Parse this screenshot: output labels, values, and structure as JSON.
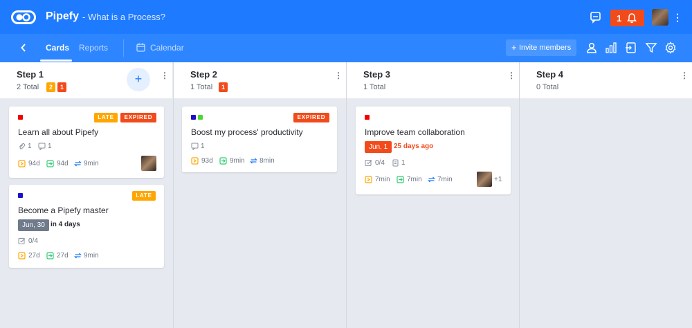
{
  "colors": {
    "primary": "#1e7bff",
    "late": "#ffa600",
    "expired": "#f24b1b",
    "label_red": "#f50000",
    "label_blue": "#1a12c8",
    "label_green": "#4cd631",
    "time_orange": "#ffa600",
    "time_green": "#2ecc71",
    "time_blue": "#1e7bff"
  },
  "topbar": {
    "app_name": "Pipefy",
    "pipe_title": "- What is a Process?",
    "notification_count": "1",
    "icons": [
      "pipefy-logo-icon",
      "chat-icon",
      "bell-icon",
      "user-avatar",
      "kebab-icon"
    ]
  },
  "nav": {
    "tabs": {
      "cards": "Cards",
      "reports": "Reports",
      "calendar": "Calendar"
    },
    "invite_label": "Invite members",
    "invite_plus": "+",
    "icons": [
      "back-icon",
      "calendar-icon",
      "person-icon",
      "bar-chart-icon",
      "import-icon",
      "filter-icon",
      "settings-icon"
    ]
  },
  "columns": [
    {
      "title": "Step 1",
      "total": "2 Total",
      "badges": [
        "2",
        "1"
      ],
      "add_button": "+"
    },
    {
      "title": "Step 2",
      "total": "1 Total",
      "badges": [
        "1"
      ]
    },
    {
      "title": "Step 3",
      "total": "1 Total",
      "badges": []
    },
    {
      "title": "Step 4",
      "total": "0 Total",
      "badges": []
    }
  ],
  "cards": [
    {
      "title": "Learn all about Pipefy",
      "tags": [
        "LATE",
        "EXPIRED"
      ],
      "attachments": "1",
      "comments": "1",
      "time_in_phase": "94d",
      "time_total": "94d",
      "time_cycle": "9min"
    },
    {
      "title": "Become a Pipefy master",
      "tags": [
        "LATE"
      ],
      "due_date": "Jun, 30",
      "due_text": "in 4 days",
      "checklist": "0/4",
      "time_in_phase": "27d",
      "time_total": "27d",
      "time_cycle": "9min"
    },
    {
      "title": "Boost my process' productivity",
      "tags": [
        "EXPIRED"
      ],
      "comments": "1",
      "time_in_phase": "93d",
      "time_total": "9min",
      "time_cycle": "8min"
    },
    {
      "title": "Improve team collaboration",
      "tags": [],
      "due_date": "Jun, 1",
      "due_text": "25 days ago",
      "checklist": "0/4",
      "attachments": "1",
      "time_in_phase": "7min",
      "time_total": "7min",
      "time_cycle": "7min",
      "extra_members": "+1"
    }
  ]
}
